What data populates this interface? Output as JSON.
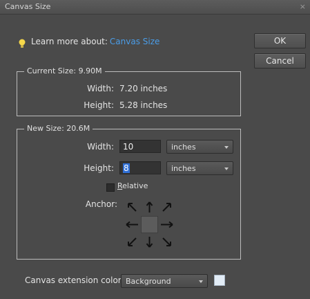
{
  "window": {
    "title": "Canvas Size",
    "close_label": "×"
  },
  "help": {
    "prefix": "Learn more about:",
    "link": "Canvas Size"
  },
  "buttons": {
    "ok": "OK",
    "cancel": "Cancel"
  },
  "current_size": {
    "legend": "Current Size: 9.90M",
    "width_label": "Width:",
    "width_value": "7.20 inches",
    "height_label": "Height:",
    "height_value": "5.28 inches"
  },
  "new_size": {
    "legend": "New Size: 20.6M",
    "width_label": "Width:",
    "width_value": "10",
    "width_unit": "inches",
    "height_label": "Height:",
    "height_value": "8",
    "height_unit": "inches",
    "relative_u": "R",
    "relative_rest": "elative",
    "relative_checked": false,
    "anchor_label": "Anchor:"
  },
  "extension": {
    "label": "Canvas extension color:",
    "value": "Background",
    "swatch_color": "#e2ecf6"
  },
  "icons": {
    "bulb": "lightbulb-icon",
    "arrows": [
      "arrow-nw-icon",
      "arrow-n-icon",
      "arrow-ne-icon",
      "arrow-w-icon",
      "arrow-e-icon",
      "arrow-sw-icon",
      "arrow-s-icon",
      "arrow-se-icon"
    ]
  }
}
